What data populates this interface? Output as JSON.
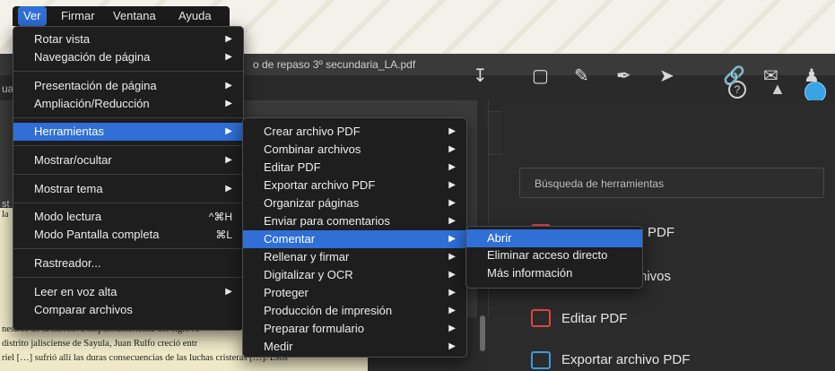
{
  "window": {
    "title": "o de repaso 3º secundaria_LA.pdf",
    "left_fragment": "ua"
  },
  "menubar": {
    "items": [
      "Ver",
      "Firmar",
      "Ventana",
      "Ayuda"
    ],
    "active": "Ver"
  },
  "ver_menu": {
    "items": [
      {
        "label": "Rotar vista",
        "arrow": "▶"
      },
      {
        "label": "Navegación de página",
        "arrow": "▶"
      },
      {
        "label": "Presentación de página",
        "arrow": "▶"
      },
      {
        "label": "Ampliación/Reducción",
        "arrow": "▶"
      },
      {
        "label": "Herramientas",
        "arrow": "▶"
      },
      {
        "label": "Mostrar/ocultar",
        "arrow": "▶"
      },
      {
        "label": "Mostrar tema",
        "arrow": "▶"
      },
      {
        "label": "Modo lectura",
        "shortcut": "^⌘H"
      },
      {
        "label": "Modo Pantalla completa",
        "shortcut": "⌘L"
      },
      {
        "label": "Rastreador..."
      },
      {
        "label": "Leer en voz alta",
        "arrow": "▶"
      },
      {
        "label": "Comparar archivos"
      }
    ]
  },
  "herramientas_menu": {
    "items": [
      "Crear archivo PDF",
      "Combinar archivos",
      "Editar PDF",
      "Exportar archivo PDF",
      "Organizar páginas",
      "Enviar para comentarios",
      "Comentar",
      "Rellenar y firmar",
      "Digitalizar y OCR",
      "Proteger",
      "Producción de impresión",
      "Preparar formulario",
      "Medir"
    ],
    "arrow": "▶"
  },
  "comentar_menu": {
    "items": [
      "Abrir",
      "Eliminar acceso directo",
      "Más información"
    ]
  },
  "right_panel": {
    "search_placeholder": "Búsqueda de herramientas",
    "items": [
      {
        "label": "PDF",
        "color": "#e0443e"
      },
      {
        "label": "hivos",
        "color": "#e0443e"
      },
      {
        "label": "Editar PDF",
        "color": "#e0443e"
      },
      {
        "label": "Exportar archivo PDF",
        "color": "#3a9de0"
      }
    ]
  },
  "document": {
    "side_text": "st",
    "left_snippet": "la",
    "lines": [
      "nestros de la narrativa hispanoamericana del siglo X",
      "distrito jalisciense de Sayula, Juan Rulfo creció entr",
      "riel […] sufrió allí las duras consecuencias de las luchas cristeras […]. Esos"
    ]
  },
  "colors": {
    "accent": "#2f6fd6",
    "menu_bg": "#1e1e1e"
  }
}
